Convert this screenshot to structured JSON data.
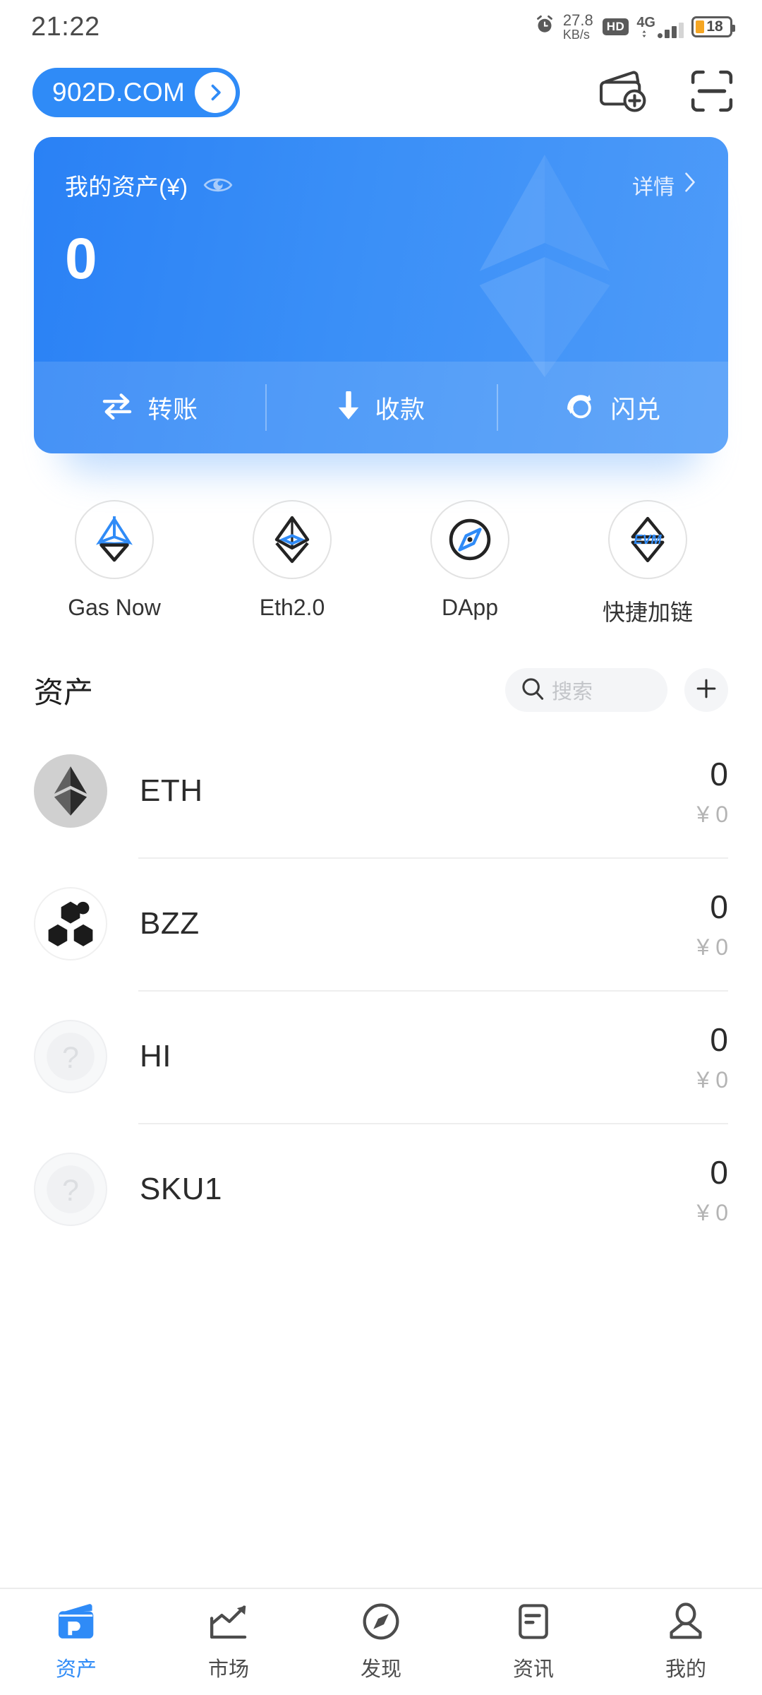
{
  "statusbar": {
    "time": "21:22",
    "alarm_icon": "alarm-clock-icon",
    "net_speed_value": "27.8",
    "net_speed_unit": "KB/s",
    "hd_badge": "HD",
    "network_type": "4G",
    "battery_percent": "18"
  },
  "header": {
    "wallet_name": "902D.COM",
    "chip_arrow_icon": "chevron-right-icon",
    "add_wallet_icon": "add-wallet-icon",
    "scan_icon": "qr-scan-icon"
  },
  "balance_card": {
    "label": "我的资产(¥)",
    "eye_icon": "eye-toggle-icon",
    "detail_label": "详情",
    "detail_arrow_icon": "chevron-right-icon",
    "amount": "0",
    "watermark_icon": "ethereum-diamond-watermark",
    "accent_color": "#2f8bf7",
    "actions": [
      {
        "label": "转账",
        "icon": "transfer-icon"
      },
      {
        "label": "收款",
        "icon": "receive-down-arrow-icon"
      },
      {
        "label": "闪兑",
        "icon": "flash-swap-icon"
      }
    ]
  },
  "quick_entries": [
    {
      "label": "Gas Now",
      "icon": "gas-now-icon"
    },
    {
      "label": "Eth2.0",
      "icon": "eth2-diamond-icon"
    },
    {
      "label": "DApp",
      "icon": "compass-icon"
    },
    {
      "label": "快捷加链",
      "icon": "evm-chain-icon"
    }
  ],
  "assets": {
    "title": "资产",
    "search_placeholder": "搜索",
    "search_value": "",
    "search_icon": "search-icon",
    "add_icon": "plus-icon",
    "tokens": [
      {
        "symbol": "ETH",
        "balance": "0",
        "fiat": "¥ 0",
        "logo": "ethereum-logo"
      },
      {
        "symbol": "BZZ",
        "balance": "0",
        "fiat": "¥ 0",
        "logo": "swarm-bzz-logo"
      },
      {
        "symbol": "HI",
        "balance": "0",
        "fiat": "¥ 0",
        "logo": "unknown-token-logo"
      },
      {
        "symbol": "SKU1",
        "balance": "0",
        "fiat": "¥ 0",
        "logo": "unknown-token-logo"
      }
    ]
  },
  "tabbar": {
    "active_index": 0,
    "items": [
      {
        "label": "资产",
        "icon": "wallet-icon"
      },
      {
        "label": "市场",
        "icon": "market-chart-icon"
      },
      {
        "label": "发现",
        "icon": "compass-icon"
      },
      {
        "label": "资讯",
        "icon": "news-document-icon"
      },
      {
        "label": "我的",
        "icon": "person-icon"
      }
    ]
  }
}
